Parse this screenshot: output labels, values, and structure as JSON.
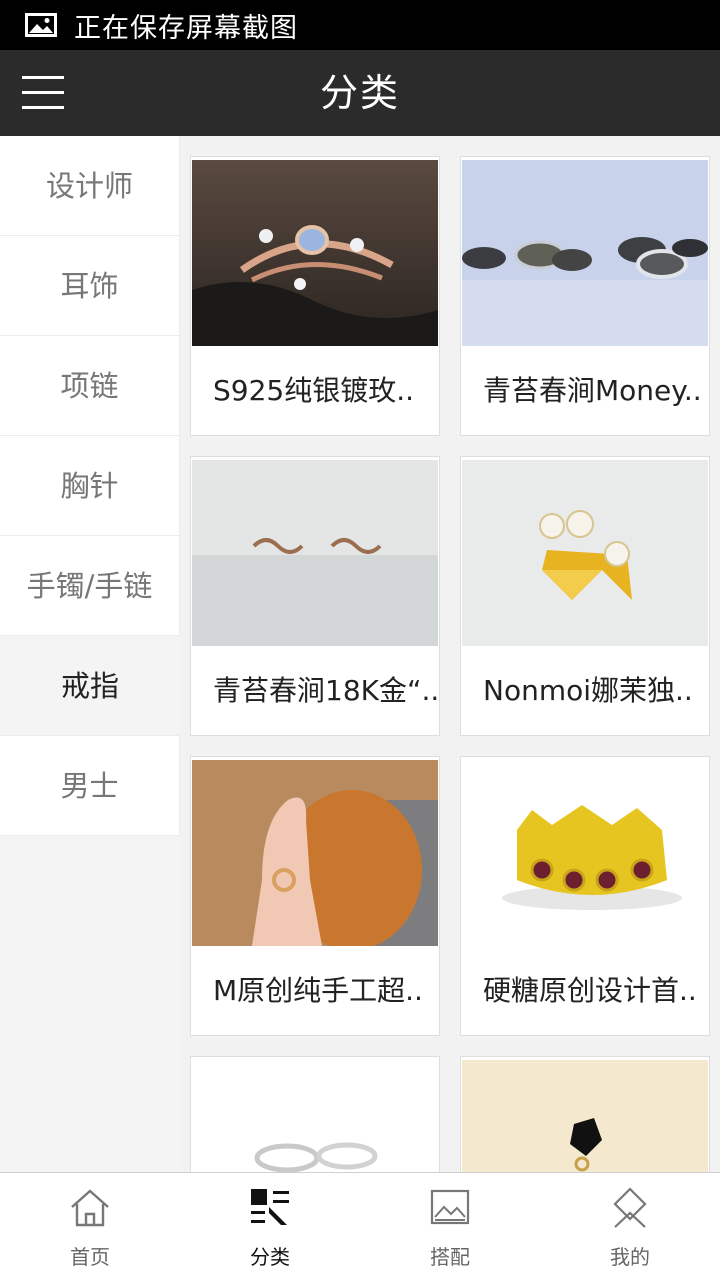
{
  "status_bar": {
    "text": "正在保存屏幕截图",
    "icon": "image-icon"
  },
  "header": {
    "title": "分类",
    "menu_icon": "hamburger-icon"
  },
  "sidebar": {
    "items": [
      {
        "label": "设计师",
        "active": false
      },
      {
        "label": "耳饰",
        "active": false
      },
      {
        "label": "项链",
        "active": false
      },
      {
        "label": "胸针",
        "active": false
      },
      {
        "label": "手镯/手链",
        "active": false
      },
      {
        "label": "戒指",
        "active": true
      },
      {
        "label": "男士",
        "active": false
      }
    ]
  },
  "products": [
    {
      "name": "S925纯银镀玫..",
      "image": "rose-gold-moonstone-ring"
    },
    {
      "name": "青苔春涧Money..",
      "image": "silver-coin-rings"
    },
    {
      "name": "青苔春涧18K金“..",
      "image": "gold-infinity-earrings"
    },
    {
      "name": "Nonmoi娜茉独..",
      "image": "gold-pearl-ring"
    },
    {
      "name": "M原创纯手工超..",
      "image": "hand-with-ring-on-cat"
    },
    {
      "name": "硬糖原创设计首..",
      "image": "gold-crown-ring-red-stones"
    },
    {
      "name": "",
      "image": "silver-open-rings"
    },
    {
      "name": "",
      "image": "black-stone-ring"
    }
  ],
  "bottom_nav": {
    "items": [
      {
        "label": "首页",
        "icon": "home-icon",
        "active": false
      },
      {
        "label": "分类",
        "icon": "category-icon",
        "active": true
      },
      {
        "label": "搭配",
        "icon": "picture-frame-icon",
        "active": false
      },
      {
        "label": "我的",
        "icon": "diamond-person-icon",
        "active": false
      }
    ]
  },
  "colors": {
    "header_bg": "#2b2b2b",
    "status_bg": "#000000",
    "active_nav": "#111111",
    "inactive_text": "#777777"
  }
}
